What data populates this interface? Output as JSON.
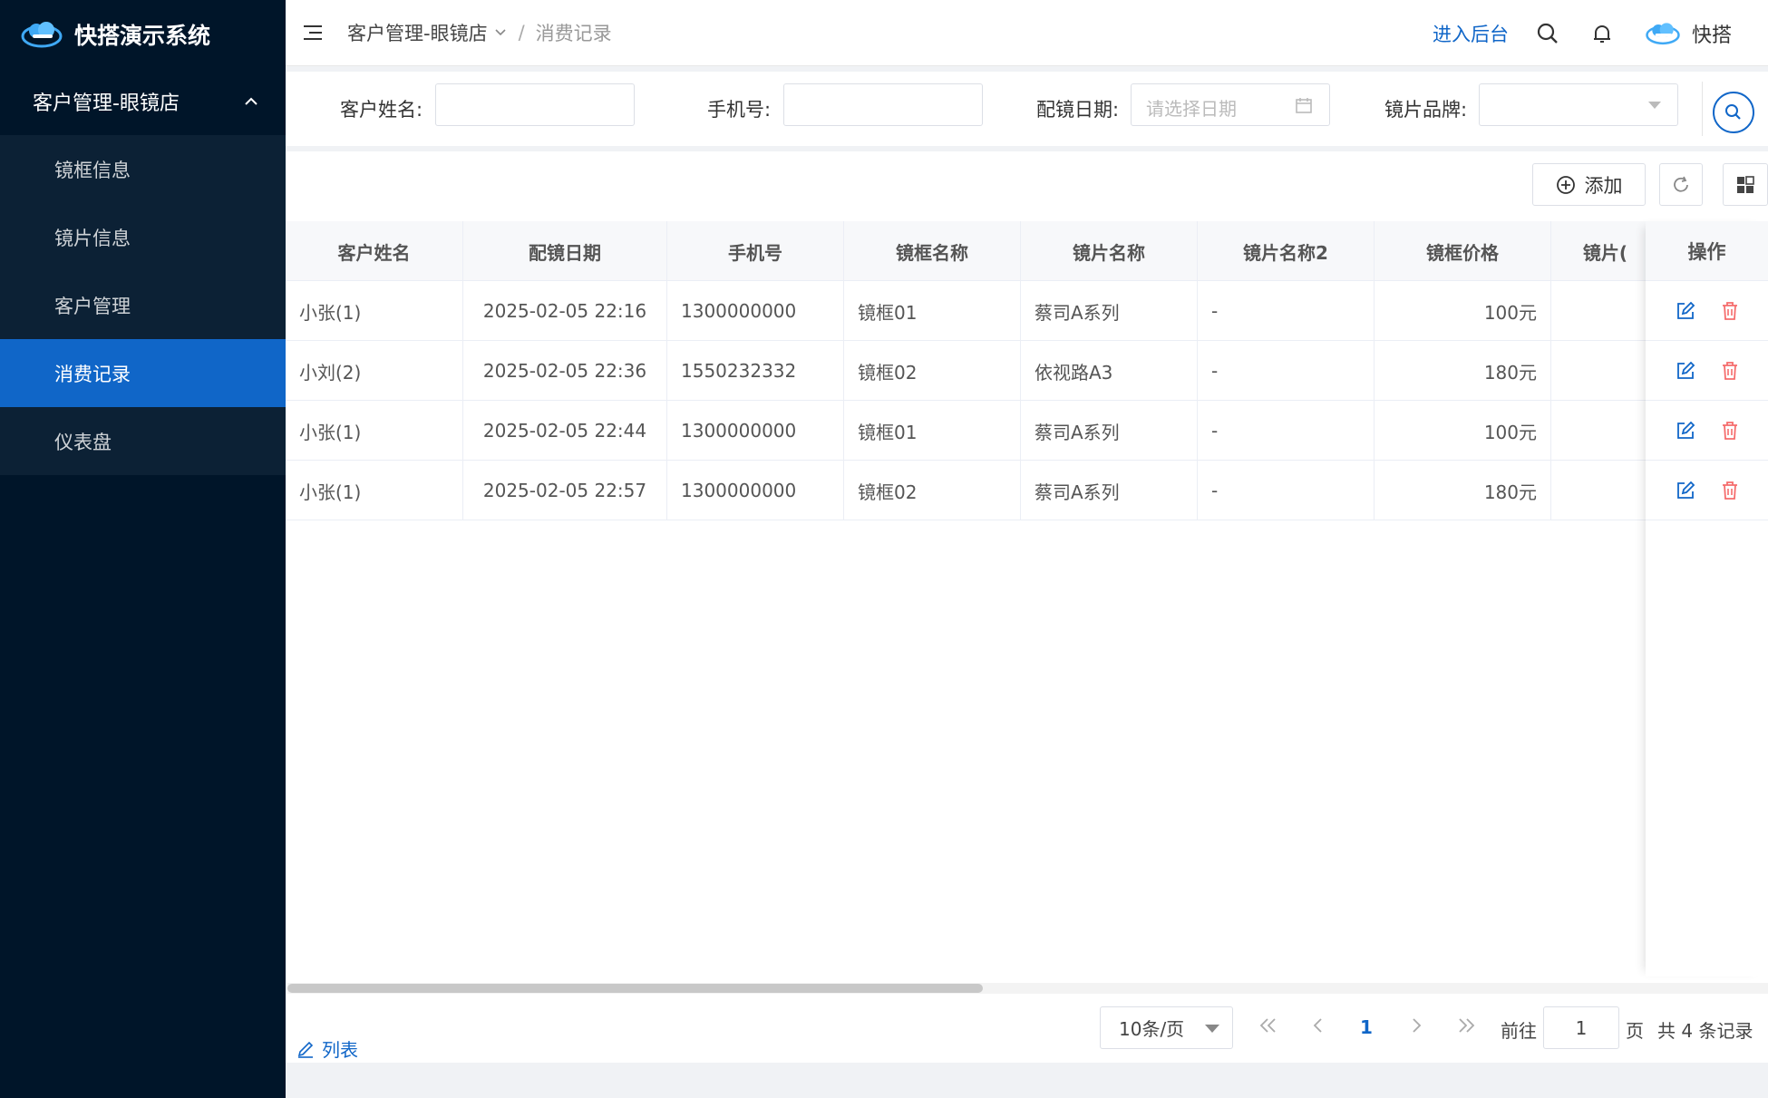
{
  "app": {
    "title": "快搭演示系统"
  },
  "sidebar": {
    "group_label": "客户管理-眼镜店",
    "items": [
      {
        "label": "镜框信息",
        "active": false
      },
      {
        "label": "镜片信息",
        "active": false
      },
      {
        "label": "客户管理",
        "active": false
      },
      {
        "label": "消费记录",
        "active": true
      },
      {
        "label": "仪表盘",
        "active": false
      }
    ]
  },
  "header": {
    "breadcrumb": [
      "客户管理-眼镜店",
      "消费记录"
    ],
    "separator": "/",
    "enter_admin": "进入后台",
    "user_name": "快搭"
  },
  "filter": {
    "customer_name_label": "客户姓名:",
    "phone_label": "手机号:",
    "date_label": "配镜日期:",
    "date_placeholder": "请选择日期",
    "brand_label": "镜片品牌:"
  },
  "toolbar": {
    "add_label": "添加"
  },
  "table": {
    "columns": [
      "客户姓名",
      "配镜日期",
      "手机号",
      "镜框名称",
      "镜片名称",
      "镜片名称2",
      "镜框价格",
      "镜片价格"
    ],
    "more_col_visible": "镜片(",
    "op_column": "操作",
    "rows": [
      {
        "name": "小张(1)",
        "date": "2025-02-05 22:16",
        "phone": "1300000000",
        "frame": "镜框01",
        "lens": "蔡司A系列",
        "lens2": "-",
        "price": "100元"
      },
      {
        "name": "小刘(2)",
        "date": "2025-02-05 22:36",
        "phone": "1550232332",
        "frame": "镜框02",
        "lens": "依视路A3",
        "lens2": "-",
        "price": "180元"
      },
      {
        "name": "小张(1)",
        "date": "2025-02-05 22:44",
        "phone": "1300000000",
        "frame": "镜框01",
        "lens": "蔡司A系列",
        "lens2": "-",
        "price": "100元"
      },
      {
        "name": "小张(1)",
        "date": "2025-02-05 22:57",
        "phone": "1300000000",
        "frame": "镜框02",
        "lens": "蔡司A系列",
        "lens2": "-",
        "price": "180元"
      }
    ]
  },
  "pagination": {
    "page_size": "10条/页",
    "current_page": "1",
    "goto_label": "前往",
    "goto_value": "1",
    "page_unit": "页",
    "total_text": "共 4 条记录"
  },
  "footer": {
    "list_link": "列表"
  },
  "colors": {
    "sidebar_bg": "#001529",
    "active": "#1066c8",
    "danger": "#f56c6c"
  }
}
